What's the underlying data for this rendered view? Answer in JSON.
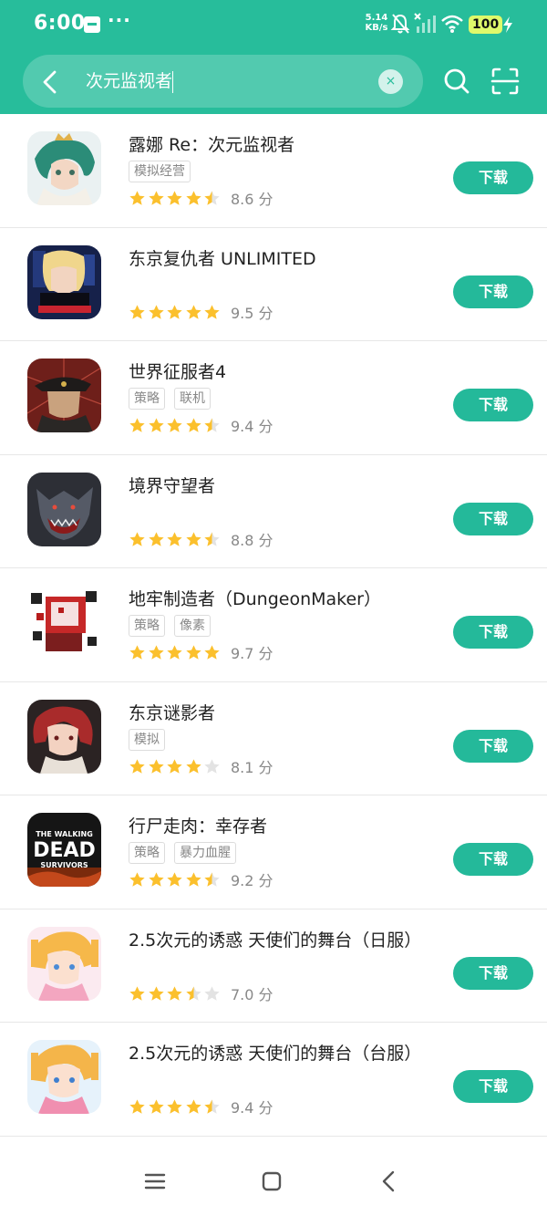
{
  "status": {
    "time": "6:00",
    "speed_value": "5.14",
    "speed_unit": "KB/s",
    "battery": "100",
    "more": "···"
  },
  "search": {
    "query": "次元监视者",
    "clear": "×"
  },
  "colors": {
    "accent": "#27bd9b",
    "button": "#24b99a",
    "star": "#fbc02d",
    "star_empty": "#e3e3e3"
  },
  "apps": [
    {
      "name": "露娜 Re：次元监视者",
      "tags": [
        "模拟经营"
      ],
      "rating": 4.5,
      "score": "8.6 分",
      "action": "下载",
      "icon": "anime-green-hair-character-icon"
    },
    {
      "name": "东京复仇者 UNLIMITED",
      "tags": [],
      "rating": 5,
      "score": "9.5 分",
      "action": "下载",
      "icon": "tokyo-revengers-icon"
    },
    {
      "name": "世界征服者4",
      "tags": [
        "策略",
        "联机"
      ],
      "rating": 4.5,
      "score": "9.4 分",
      "action": "下载",
      "icon": "military-officer-icon"
    },
    {
      "name": "境界守望者",
      "tags": [],
      "rating": 4.5,
      "score": "8.8 分",
      "action": "下载",
      "icon": "werewolf-icon"
    },
    {
      "name": "地牢制造者（DungeonMaker）",
      "tags": [
        "策略",
        "像素"
      ],
      "rating": 5,
      "score": "9.7 分",
      "action": "下载",
      "icon": "pixel-dungeon-icon"
    },
    {
      "name": "东京谜影者",
      "tags": [
        "模拟"
      ],
      "rating": 4,
      "score": "8.1 分",
      "action": "下载",
      "icon": "red-hair-character-icon"
    },
    {
      "name": "行尸走肉：幸存者",
      "tags": [
        "策略",
        "暴力血腥"
      ],
      "rating": 4.5,
      "score": "9.2 分",
      "action": "下载",
      "icon": "walking-dead-icon",
      "icon_text": [
        "THE WALKING",
        "DEAD",
        "SURVIVORS"
      ]
    },
    {
      "name": "2.5次元的诱惑 天使们的舞台（日服）",
      "tags": [],
      "rating": 3.5,
      "score": "7.0 分",
      "action": "下载",
      "icon": "anime-blonde-girl-icon"
    },
    {
      "name": "2.5次元的诱惑 天使们的舞台（台服）",
      "tags": [],
      "rating": 4.5,
      "score": "9.4 分",
      "action": "下载",
      "icon": "anime-blonde-girl-icon-2"
    }
  ]
}
